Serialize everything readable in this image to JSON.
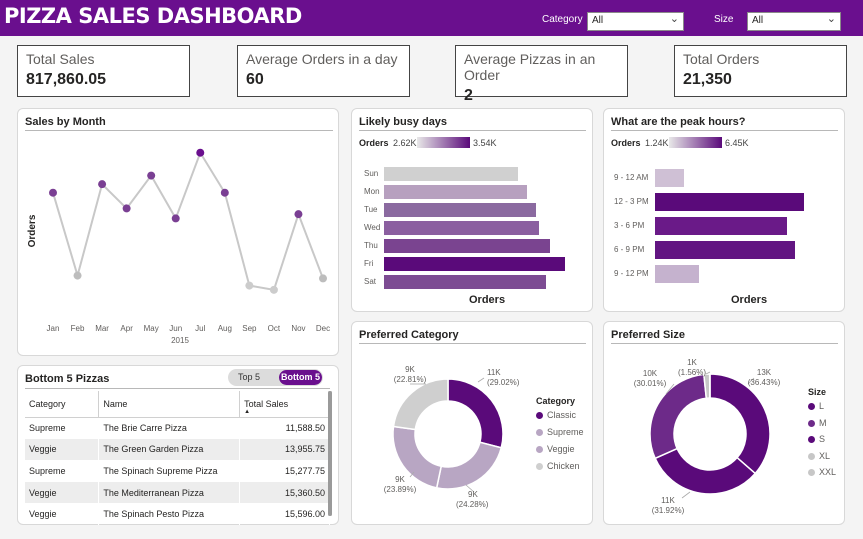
{
  "header": {
    "title": "PIZZA SALES DASHBOARD",
    "category_label": "Category",
    "category_value": "All",
    "size_label": "Size",
    "size_value": "All",
    "bg_color": "#6a0f8e"
  },
  "kpis": [
    {
      "label": "Total Sales",
      "value": "817,860.05"
    },
    {
      "label": "Average Orders in a day",
      "value": "60"
    },
    {
      "label": "Average Pizzas in an Order",
      "value": "2"
    },
    {
      "label": "Total Orders",
      "value": "21,350"
    }
  ],
  "sales_by_month": {
    "title": "Sales by Month",
    "ylabel": "Orders",
    "year_label": "2015",
    "chart_data": {
      "type": "line",
      "categories": [
        "Jan",
        "Feb",
        "Mar",
        "Apr",
        "May",
        "Jun",
        "Jul",
        "Aug",
        "Sep",
        "Oct",
        "Nov",
        "Dec"
      ],
      "values": [
        69800,
        64000,
        70400,
        68700,
        71000,
        68000,
        72600,
        69800,
        63300,
        63000,
        68300,
        63800
      ],
      "colors": [
        "#7a3f93",
        "#bdbdbd",
        "#7a3f93",
        "#7a3f93",
        "#7a3f93",
        "#7a3f93",
        "#6a0f8e",
        "#7a3f93",
        "#cccccc",
        "#cccccc",
        "#7a3f93",
        "#bdbdbd"
      ],
      "title": "Sales by Month",
      "xlabel": "",
      "ylabel": "Orders"
    }
  },
  "busy_days": {
    "title": "Likely busy days",
    "legend_label": "Orders",
    "legend_min": "2.62K",
    "legend_max": "3.54K",
    "axis_title": "Orders",
    "chart_data": {
      "type": "bar",
      "categories": [
        "Sun",
        "Mon",
        "Tue",
        "Wed",
        "Thu",
        "Fri",
        "Sat"
      ],
      "values": [
        2624,
        2794,
        2973,
        3024,
        3239,
        3538,
        3158
      ],
      "colors": [
        "#d0d0d0",
        "#b7a0bf",
        "#8b6aa0",
        "#8b5fa0",
        "#7a4490",
        "#5a0a7a",
        "#7d4c93"
      ],
      "xlabel": "Orders"
    }
  },
  "peak_hours": {
    "title": "What are the peak hours?",
    "legend_label": "Orders",
    "legend_min": "1.24K",
    "legend_max": "6.45K",
    "axis_title": "Orders",
    "chart_data": {
      "type": "bar",
      "categories": [
        "9 - 12 AM",
        "12 - 3 PM",
        "3 - 6 PM",
        "6 - 9 PM",
        "9 - 12 PM"
      ],
      "values": [
        1240,
        6450,
        5700,
        6050,
        1900
      ],
      "colors": [
        "#cfc0d5",
        "#5a0a7a",
        "#6a1a88",
        "#621582",
        "#c5b2ce"
      ],
      "xlabel": "Orders"
    }
  },
  "bottom5": {
    "title": "Bottom 5 Pizzas",
    "toggle_top": "Top 5",
    "toggle_bottom": "Bottom 5",
    "columns": [
      "Category",
      "Name",
      "Total Sales"
    ],
    "rows": [
      [
        "Supreme",
        "The Brie Carre Pizza",
        "11,588.50"
      ],
      [
        "Veggie",
        "The Green Garden Pizza",
        "13,955.75"
      ],
      [
        "Supreme",
        "The Spinach Supreme Pizza",
        "15,277.75"
      ],
      [
        "Veggie",
        "The Mediterranean Pizza",
        "15,360.50"
      ],
      [
        "Veggie",
        "The Spinach Pesto Pizza",
        "15,596.00"
      ]
    ]
  },
  "pref_category": {
    "title": "Preferred Category",
    "legend_title": "Category",
    "labels": [
      {
        "line1": "11K",
        "line2": "(29.02%)"
      },
      {
        "line1": "9K",
        "line2": "(24.28%)"
      },
      {
        "line1": "9K",
        "line2": "(23.89%)"
      },
      {
        "line1": "9K",
        "line2": "(22.81%)"
      }
    ],
    "chart_data": {
      "type": "pie",
      "categories": [
        "Classic",
        "Supreme",
        "Veggie",
        "Chicken"
      ],
      "values": [
        29.02,
        24.28,
        23.89,
        22.81
      ],
      "colors": [
        "#5a0a7a",
        "#b8a6c3",
        "#b8a6c3",
        "#cfcfcf"
      ],
      "legend_colors": [
        "#5a0a7a",
        "#b8a6c3",
        "#b8a6c3",
        "#cfcfcf"
      ],
      "title": "Preferred Category"
    }
  },
  "pref_size": {
    "title": "Preferred Size",
    "legend_title": "Size",
    "labels": [
      {
        "line1": "13K",
        "line2": "(36.43%)"
      },
      {
        "line1": "11K",
        "line2": "(31.92%)"
      },
      {
        "line1": "10K",
        "line2": "(30.01%)"
      },
      {
        "line1": "1K",
        "line2": "(1.56%)"
      }
    ],
    "chart_data": {
      "type": "pie",
      "categories": [
        "L",
        "M",
        "S",
        "XL",
        "XXL"
      ],
      "values": [
        36.43,
        31.92,
        30.01,
        1.56,
        0.08
      ],
      "colors": [
        "#5a0a7a",
        "#5a0a7a",
        "#6d2a89",
        "#c7c7c7",
        "#c7c7c7"
      ],
      "legend_colors": [
        "#5a0a7a",
        "#6d2a89",
        "#5a0a7a",
        "#c7c7c7",
        "#c7c7c7"
      ],
      "title": "Preferred Size"
    }
  }
}
